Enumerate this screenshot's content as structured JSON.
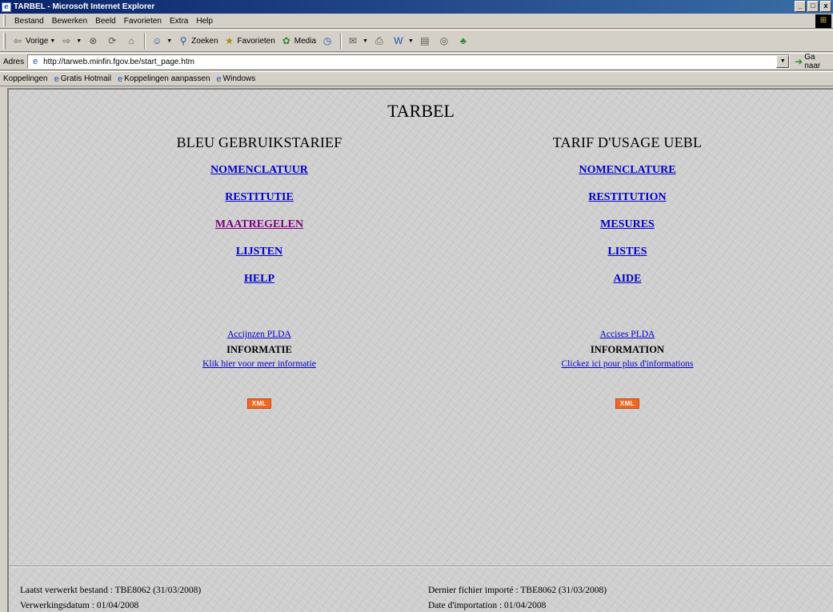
{
  "window": {
    "title": "TARBEL - Microsoft Internet Explorer"
  },
  "menu": [
    "Bestand",
    "Bewerken",
    "Beeld",
    "Favorieten",
    "Extra",
    "Help"
  ],
  "toolbar": {
    "back": "Vorige",
    "search": "Zoeken",
    "favorites": "Favorieten",
    "media": "Media"
  },
  "address": {
    "label": "Adres",
    "url": "http://tarweb.minfin.fgov.be/start_page.htm",
    "go": "Ga naar"
  },
  "links": {
    "label": "Koppelingen",
    "items": [
      "Gratis Hotmail",
      "Koppelingen aanpassen",
      "Windows"
    ]
  },
  "page": {
    "title": "TARBEL",
    "left": {
      "heading": "BLEU GEBRUIKSTARIEF",
      "nav": [
        "NOMENCLATUUR",
        "RESTITUTIE",
        "MAATREGELEN",
        "LIJSTEN",
        "HELP"
      ],
      "excise_link": "Accijnzen PLDA",
      "info_heading": "INFORMATIE",
      "info_link": "Klik hier voor meer informatie",
      "xml": "XML"
    },
    "right": {
      "heading": "TARIF D'USAGE UEBL",
      "nav": [
        "NOMENCLATURE",
        "RESTITUTION",
        "MESURES",
        "LISTES",
        "AIDE"
      ],
      "excise_link": "Accises PLDA",
      "info_heading": "INFORMATION",
      "info_link": "Clickez ici pour plus d'informations",
      "xml": "XML"
    },
    "footer": {
      "left_line1": "Laatst verwerkt bestand : TBE8062 (31/03/2008)",
      "left_line2": "Verwerkingsdatum : 01/04/2008",
      "right_line1": "Dernier fichier importé : TBE8062 (31/03/2008)",
      "right_line2": "Date d'importation : 01/04/2008"
    }
  },
  "colors": {
    "titlebar": "#0a246a",
    "link": "#0000cc",
    "visited_link": "#800080",
    "xml_badge": "#f26522"
  }
}
